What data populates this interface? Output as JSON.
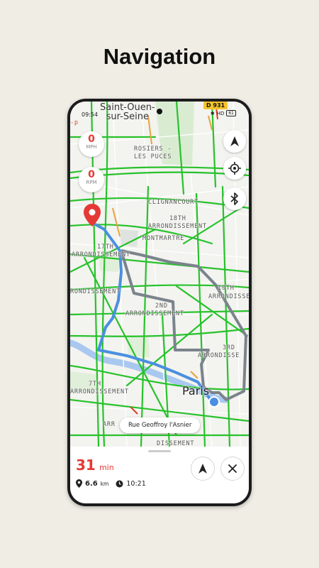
{
  "headline": "Navigation",
  "status": {
    "time": "09:54",
    "badge": "D 931",
    "hd": "HD",
    "battery": "61"
  },
  "map": {
    "top_city": [
      "Saint-Ouen-",
      "sur-Seine"
    ],
    "labels": [
      "ROSIERS -",
      "LES PUCES",
      "CLIGNANCOURT",
      "18TH",
      "ARRONDISSEMENT",
      "MONTMARTRE",
      "17TH",
      "ARRONDISSEMENT",
      "RONDISSEMENT",
      "10TH",
      "ARRONDISSE",
      "2ND",
      "ARRONDISSEMENT",
      "3RD",
      "ARRONDISSE",
      "7TH",
      "ARRONDISSEMENT",
      "ARR",
      "DISSEMENT",
      "-p"
    ],
    "city": "Paris",
    "street": "Rue Geoffroy l'Asnier"
  },
  "gauges": [
    {
      "value": "0",
      "unit": "MPH"
    },
    {
      "value": "0",
      "unit": "RPM"
    }
  ],
  "controls": {
    "compass": "navigation-arrow-icon",
    "locate": "crosshair-icon",
    "bluetooth": "bluetooth-icon"
  },
  "panel": {
    "eta_value": "31",
    "eta_unit": "min",
    "distance_value": "6.6",
    "distance_unit": "km",
    "arrival_time": "10:21"
  },
  "colors": {
    "accent": "#e53935",
    "route_active": "#4a8fe0",
    "route_alt": "#7b838c",
    "traffic_free": "#26c22a",
    "traffic_slow": "#f1a73a",
    "background": "#efede4"
  }
}
